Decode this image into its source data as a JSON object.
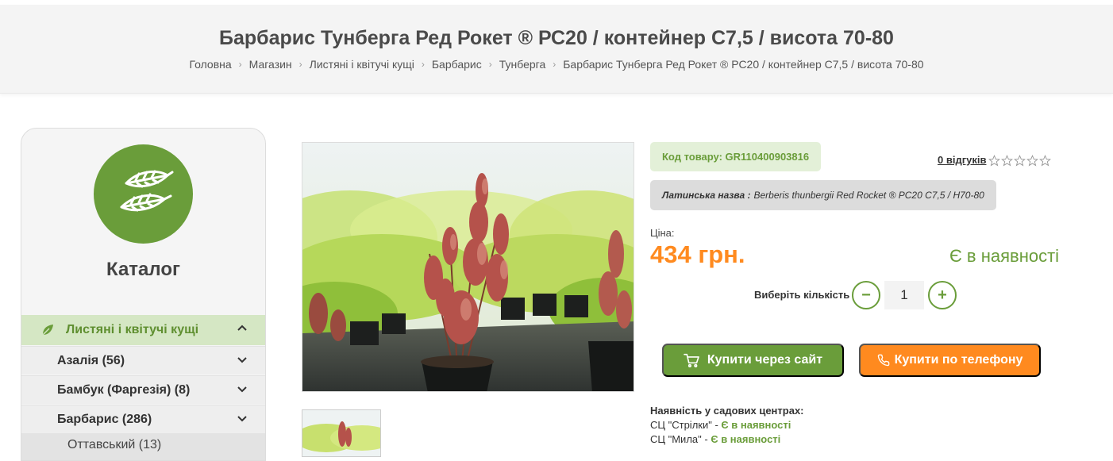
{
  "header": {
    "title": "Барбарис Тунберга Ред Рокет ® РС20 / контейнер С7,5 / висота 70-80",
    "breadcrumb": [
      "Головна",
      "Магазин",
      "Листяні і квітучі кущі",
      "Барбарис",
      "Тунберга",
      "Барбарис Тунберга Ред Рокет ® РС20 / контейнер С7,5 / висота 70-80"
    ]
  },
  "sidebar": {
    "title": "Каталог",
    "active_category": "Листяні і квітучі кущі",
    "items": [
      {
        "label": "Азалія (56)"
      },
      {
        "label": "Бамбук (Фаргезія) (8)"
      },
      {
        "label": "Барбарис (286)"
      }
    ],
    "sub_item": "Оттавський (13)"
  },
  "product": {
    "sku_label": "Код товару:",
    "sku_value": "GR110400903816",
    "reviews": "0 відгуків",
    "rating": 0,
    "rating_max": 5,
    "latin_label": "Латинська назва :",
    "latin_value": "Berberis thunbergii Red Rocket ® PC20 C7,5 / H70-80",
    "price_label": "Ціна:",
    "price": "434 грн.",
    "stock": "Є в наявності",
    "qty_label": "Виберіть кількість",
    "qty_value": "1",
    "qty_minus": "−",
    "qty_plus": "+",
    "buy_site": "Купити через сайт",
    "buy_phone": "Купити по телефону",
    "availability_title": "Наявність у садових центрах:",
    "availability": [
      {
        "center": "СЦ \"Стрілки\"",
        "status": "Є в наявності"
      },
      {
        "center": "СЦ \"Мила\"",
        "status": "Є в наявності"
      }
    ]
  },
  "colors": {
    "green": "#6a9d3a",
    "orange": "#ff8a1f",
    "light_green": "#d5e7c4"
  }
}
